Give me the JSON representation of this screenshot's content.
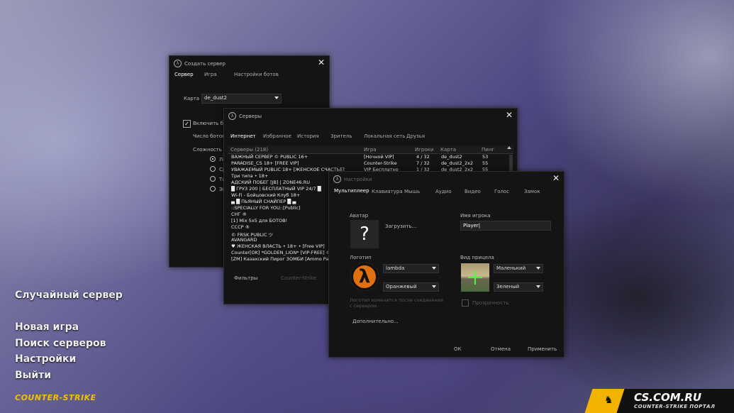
{
  "main_menu": {
    "random_server": "Случайный сервер",
    "items": [
      "Новая игра",
      "Поиск серверов",
      "Настройки",
      "Выйти"
    ],
    "game_logo": "COUNTER-STRIKE"
  },
  "watermark": {
    "site": "CS.COM.RU",
    "tagline": "COUNTER-STRIKE ПОРТАЛ"
  },
  "create_server": {
    "title": "Создать сервер",
    "tabs": [
      "Сервер",
      "Игра",
      "Настройки ботов"
    ],
    "map_label": "Карта",
    "map_value": "de_dust2",
    "enable_bots": "Включить бот",
    "bot_count": "Число ботов",
    "difficulty": "Сложность",
    "diff_options": [
      "Лё",
      "Ср",
      "Тя",
      "Эк"
    ]
  },
  "servers": {
    "title": "Серверы",
    "tabs": [
      "Интернет",
      "Избранное",
      "История",
      "Зритель",
      "Локальная сеть",
      "Друзья"
    ],
    "columns": [
      "Серверы (218)",
      "Игра",
      "Игроки",
      "Карта",
      "Пинг"
    ],
    "rows": [
      {
        "name": "ВАЖНЫЙ СЕРВЕР © PUBLIC 16+",
        "game": "[Ночной VIP]",
        "players": "4 / 32",
        "map": "de_dust2",
        "ping": "53"
      },
      {
        "name": "PARADISE_CS 18+ [FREE VIP]",
        "game": "Counter-Strike",
        "players": "7 / 32",
        "map": "de_dust2_2x2",
        "ping": "55"
      },
      {
        "name": "УВАЖАЕМЫЙ PUBLIC 18+ [ЖЕНСКОЕ СЧАСТЬЕ]",
        "game": "VIP Бесплатно",
        "players": "1 / 32",
        "map": "de_dust2_2x2",
        "ping": "55"
      },
      {
        "name": "Три типа • 18+",
        "game": "",
        "players": "",
        "map": "",
        "ping": ""
      },
      {
        "name": "АДСКИЙ ПОБЕГ [JB] | ZONE46.RU",
        "game": "",
        "players": "",
        "map": "",
        "ping": ""
      },
      {
        "name": "█ ГРУЗ 200 | БЕСПЛАТНЫЙ VIP 24/7 █",
        "game": "",
        "players": "",
        "map": "",
        "ping": ""
      },
      {
        "name": "Wi-Fi - Бойцовский Клуб 18+",
        "game": "",
        "players": "",
        "map": "",
        "ping": ""
      },
      {
        "name": "▄ █ ПЬЯНЫЙ СНАЙПЕР █ ▄",
        "game": "",
        "players": "",
        "map": "",
        "ping": ""
      },
      {
        "name": "::SPECIALLY FOR YOU::[Public]",
        "game": "",
        "players": "",
        "map": "",
        "ping": ""
      },
      {
        "name": "СНГ ®",
        "game": "",
        "players": "",
        "map": "",
        "ping": ""
      },
      {
        "name": "[1] Mix 5x5 для БОТОВ!",
        "game": "",
        "players": "",
        "map": "",
        "ping": ""
      },
      {
        "name": "СССР ®",
        "game": "",
        "players": "",
        "map": "",
        "ping": ""
      },
      {
        "name": "© FRSK PUBLIC ツ",
        "game": "",
        "players": "",
        "map": "",
        "ping": ""
      },
      {
        "name": "AVANGARD",
        "game": "",
        "players": "",
        "map": "",
        "ping": ""
      },
      {
        "name": "♥ ЖЕНСКАЯ ВЛАСТЬ • 18+ • [Free VIP]",
        "game": "",
        "players": "",
        "map": "",
        "ping": ""
      },
      {
        "name": "Counter[OK] *GOLDEN_LION* [VIP-FREE] ©",
        "game": "",
        "players": "",
        "map": "",
        "ping": ""
      },
      {
        "name": "[ZM] Казахский Пирог ЗОМБИ [Ammo Pack]",
        "game": "",
        "players": "",
        "map": "",
        "ping": ""
      }
    ],
    "filters": "Фильтры",
    "filter_game": "Counter-Strike"
  },
  "settings": {
    "title": "Настройки",
    "tabs": [
      "Мультиплеер",
      "Клавиатура",
      "Мышь",
      "Аудио",
      "Видео",
      "Голос",
      "Замок"
    ],
    "avatar_label": "Аватар",
    "avatar_glyph": "?",
    "load_link": "Загрузить...",
    "player_name_label": "Имя игрока",
    "player_name_value": "Player",
    "logo_label": "Логотип",
    "logo_value": "lambda",
    "logo_color": "Оранжевый",
    "logo_glyph": "λ",
    "logo_note": "Логотип изменится после соединения с сервером.",
    "crosshair_label": "Вид прицела",
    "crosshair_size": "Маленький",
    "crosshair_color": "Зеленый",
    "transparency": "Прозрачность",
    "advanced": "Дополнительно...",
    "ok": "ОК",
    "cancel": "Отмена",
    "apply": "Применить"
  }
}
